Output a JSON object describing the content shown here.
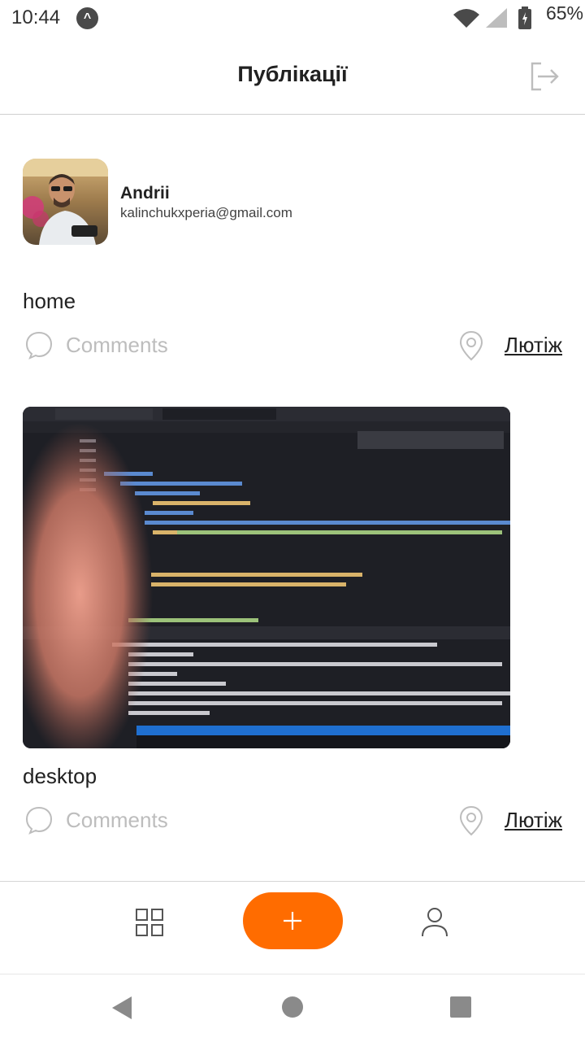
{
  "status_bar": {
    "time": "10:44",
    "battery": "65%"
  },
  "header": {
    "title": "Публікації",
    "logout_icon": "logout-icon"
  },
  "profile": {
    "name": "Andrii",
    "email": "kalinchukxperia@gmail.com"
  },
  "posts": [
    {
      "name": "home",
      "comments_label": "Comments",
      "location": "Лютіж"
    },
    {
      "name": "desktop",
      "comments_label": "Comments",
      "location": "Лютіж"
    }
  ],
  "tab_bar": {
    "items": [
      "grid-icon",
      "add-post-icon",
      "user-icon"
    ]
  },
  "colors": {
    "accent": "#ff6c00",
    "text": "#212121",
    "muted": "#bdbdbd",
    "divider": "#cfcfcf"
  }
}
